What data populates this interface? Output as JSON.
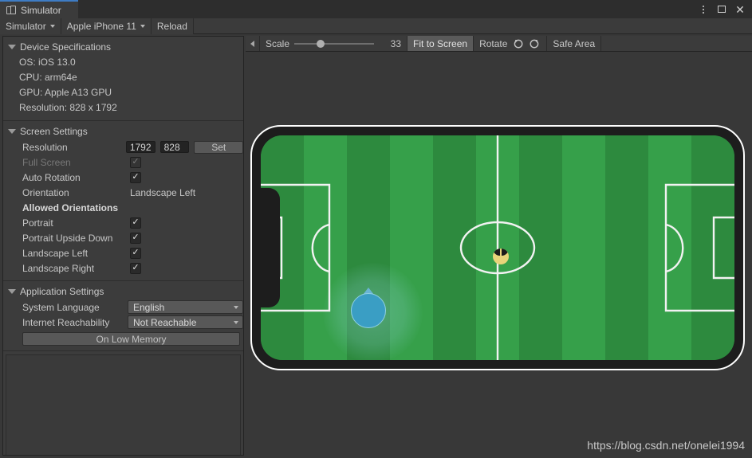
{
  "window": {
    "tab_label": "Simulator",
    "tab_icon": "simulator-icon",
    "controls": {
      "menu": "kebab-menu-icon",
      "maximize": "maximize-icon",
      "close": "close-icon"
    }
  },
  "toolbar": {
    "mode_label": "Simulator",
    "device_label": "Apple iPhone 11",
    "reload_label": "Reload"
  },
  "inspector": {
    "device_specs": {
      "title": "Device Specifications",
      "lines": [
        "OS: iOS 13.0",
        "CPU: arm64e",
        "GPU: Apple A13 GPU",
        "Resolution: 828 x 1792"
      ]
    },
    "screen_settings": {
      "title": "Screen Settings",
      "resolution_label": "Resolution",
      "resolution_width": "1792",
      "resolution_height": "828",
      "set_label": "Set",
      "full_screen_label": "Full Screen",
      "full_screen_checked": "✓",
      "auto_rotation_label": "Auto Rotation",
      "auto_rotation_checked": "✓",
      "orientation_label": "Orientation",
      "orientation_value": "Landscape Left",
      "allowed_orientations_label": "Allowed Orientations",
      "orientations": [
        {
          "label": "Portrait",
          "checked": "✓"
        },
        {
          "label": "Portrait Upside Down",
          "checked": "✓"
        },
        {
          "label": "Landscape Left",
          "checked": "✓"
        },
        {
          "label": "Landscape Right",
          "checked": "✓"
        }
      ]
    },
    "application_settings": {
      "title": "Application Settings",
      "system_language_label": "System Language",
      "system_language_value": "English",
      "internet_reachability_label": "Internet Reachability",
      "internet_reachability_value": "Not Reachable",
      "on_low_memory_label": "On Low Memory"
    }
  },
  "gameview_toolbar": {
    "collapse_icon": "chevron-left-icon",
    "scale_label": "Scale",
    "scale_value": "33",
    "fit_to_screen_label": "Fit to Screen",
    "rotate_label": "Rotate",
    "rotate_ccw_icon": "rotate-counterclockwise-icon",
    "rotate_cw_icon": "rotate-clockwise-icon",
    "safe_area_label": "Safe Area"
  },
  "simulation": {
    "device_orientation": "landscape-left",
    "notch_position": "left",
    "scene": "soccer-field",
    "field": {
      "stripe_count": 11,
      "stripe_colors": [
        "#2d8a3e",
        "#36a04a"
      ],
      "line_color": "#f2f2f2"
    },
    "ball": {
      "color": "#e8d47a",
      "cap_color": "#1b1b1b"
    },
    "player": {
      "color": "#3a9ec4",
      "outline": "#8fd0e2"
    }
  },
  "watermark": "https://blog.csdn.net/onelei1994",
  "colors": {
    "accent_tab": "#3e7cc4",
    "panel_bg": "#3c3c3c",
    "toolbar_bg": "#3b3b3b",
    "window_bg": "#383838",
    "text": "#c8c8c8"
  }
}
